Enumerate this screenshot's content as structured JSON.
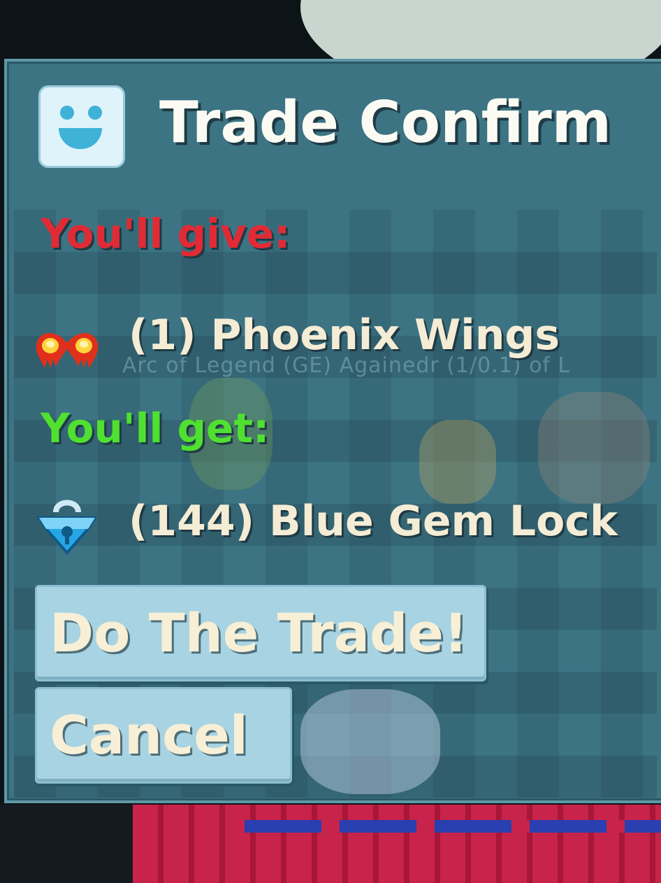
{
  "dialog": {
    "title": "Trade Confirm",
    "title_icon": "smiley-face-icon",
    "give": {
      "label": "You'll give:",
      "label_color": "#e02b36",
      "items": [
        {
          "quantity": "(1)",
          "name": "Phoenix Wings",
          "display": "(1) Phoenix Wings",
          "icon": "phoenix-wings-icon"
        }
      ]
    },
    "get": {
      "label": "You'll get:",
      "label_color": "#4fe030",
      "items": [
        {
          "quantity": "(144)",
          "name": "Blue Gem Lock",
          "display": "(144) Blue Gem Lock",
          "icon": "blue-gem-lock-icon"
        }
      ]
    },
    "buttons": {
      "confirm": "Do The Trade!",
      "cancel": "Cancel"
    }
  },
  "background": {
    "faded_chat_text": "Arc of Legend (GE) Againedr (1/0.1) of L",
    "panel_color": "#3c7484",
    "floor_color": "#c8234a"
  }
}
